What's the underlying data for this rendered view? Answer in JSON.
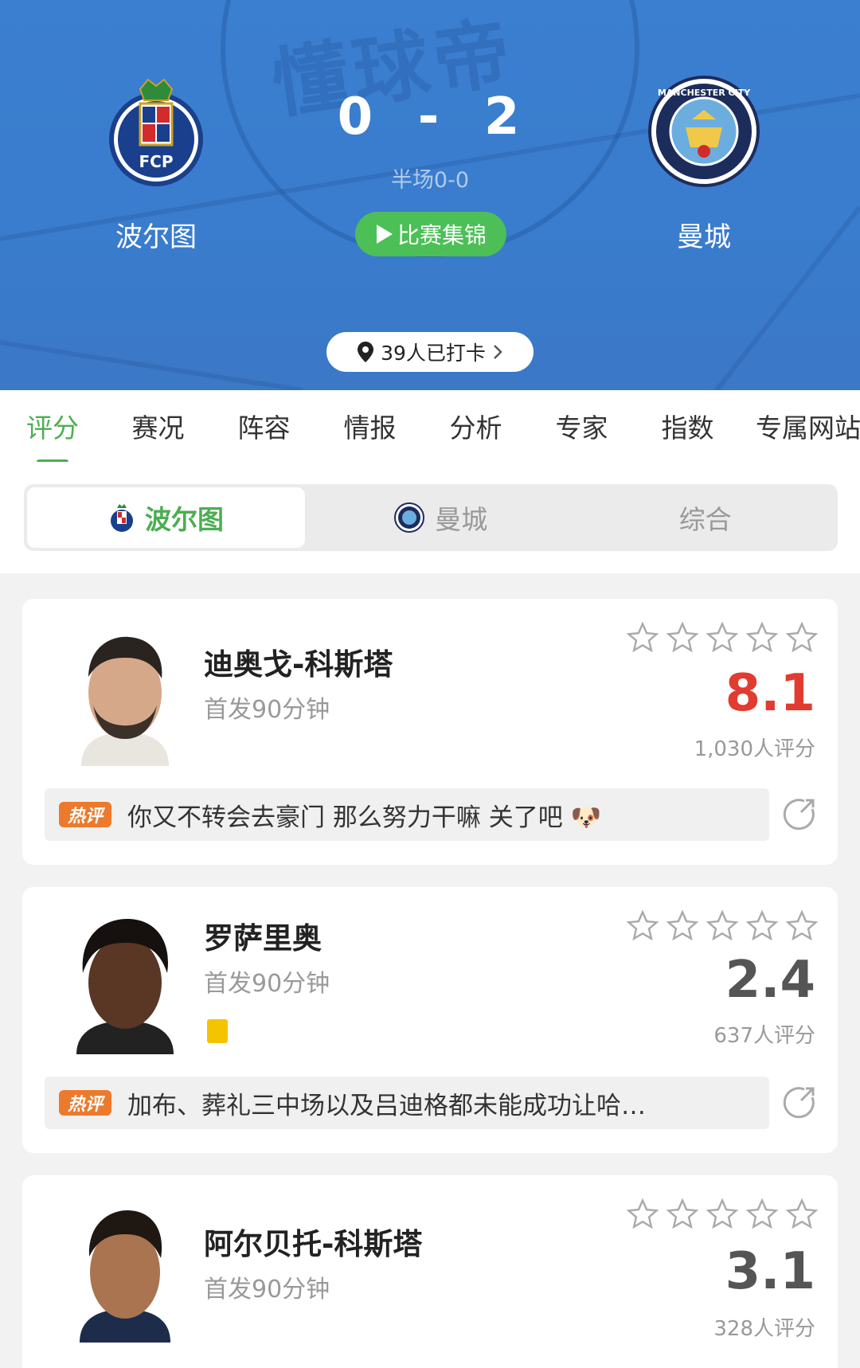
{
  "header": {
    "watermark": "懂球帝",
    "home_team": "波尔图",
    "away_team": "曼城",
    "home_crest_letters": "FCP",
    "away_crest_text": "MANCHESTER CITY",
    "score_home": "0",
    "score_sep": "-",
    "score_away": "2",
    "halftime": "半场0-0",
    "highlights_label": "比赛集锦",
    "checkin_label": "39人已打卡",
    "colors": {
      "hero": "#3b7fd0",
      "accent_green": "#4cae52"
    }
  },
  "tabs": [
    "评分",
    "赛况",
    "阵容",
    "情报",
    "分析",
    "专家",
    "指数",
    "专属网站"
  ],
  "segment": {
    "items": [
      "波尔图",
      "曼城",
      "综合"
    ],
    "active": "波尔图"
  },
  "players": [
    {
      "name": "迪奥戈-科斯塔",
      "minutes": "首发90分钟",
      "rating": "8.1",
      "rating_color": "#e23b2f",
      "count": "1,030人评分",
      "hot_badge": "热评",
      "hot_text": "你又不转会去豪门 那么努力干嘛 关了吧 🐶",
      "yellow_card": false
    },
    {
      "name": "罗萨里奥",
      "minutes": "首发90分钟",
      "rating": "2.4",
      "rating_color": "#555555",
      "count": "637人评分",
      "hot_badge": "热评",
      "hot_text": "加布、葬礼三中场以及吕迪格都未能成功让哈…",
      "yellow_card": true
    },
    {
      "name": "阿尔贝托-科斯塔",
      "minutes": "首发90分钟",
      "rating": "3.1",
      "rating_color": "#555555",
      "count": "328人评分"
    }
  ]
}
